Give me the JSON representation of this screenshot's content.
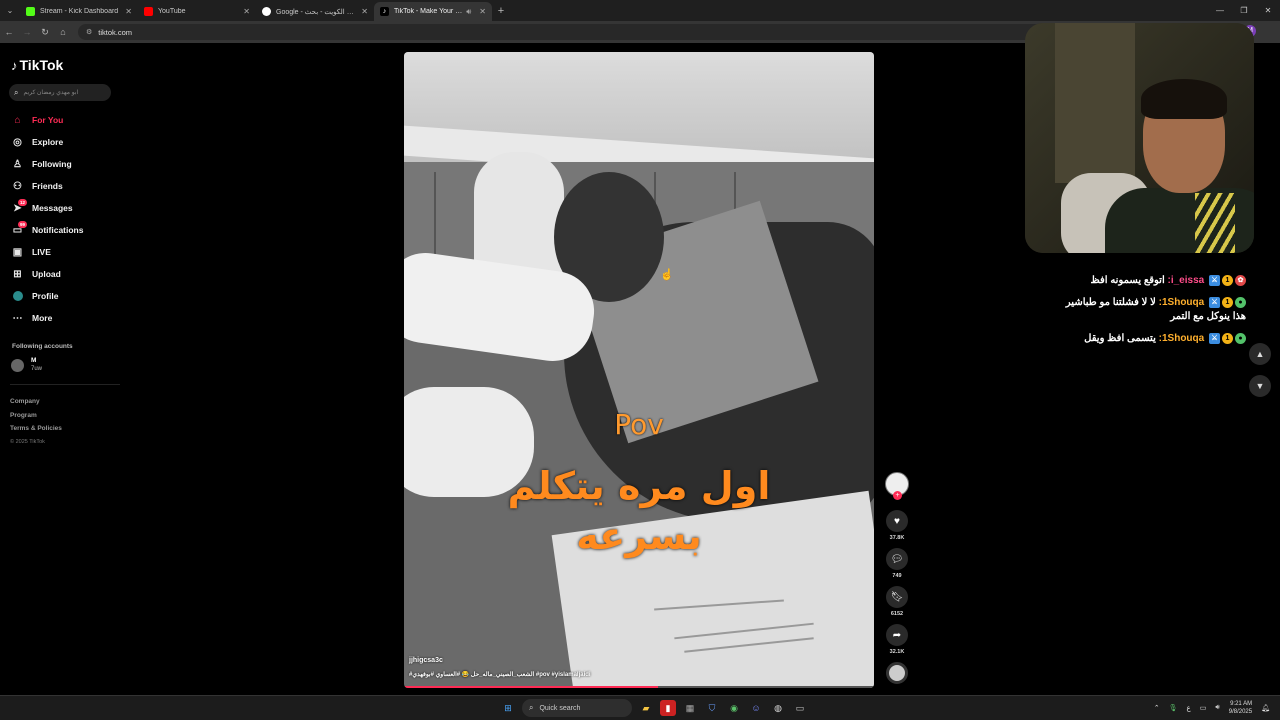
{
  "browser": {
    "tabs": [
      {
        "title": "Stream - Kick Dashboard",
        "favicon_color": "#53fc18",
        "active": false
      },
      {
        "title": "YouTube",
        "favicon_color": "#ff0000",
        "active": false
      },
      {
        "title": "Google - برجر جياني الكويت - بحث",
        "favicon_color": "#4285f4",
        "active": false
      },
      {
        "title": "TikTok - Make Your Day",
        "favicon_color": "#000000",
        "active": true
      }
    ],
    "url": "tiktok.com",
    "profile_initial": "M"
  },
  "sidebar": {
    "logo": "TikTok",
    "search_placeholder": "ابو مهدي رمضان كريم",
    "menu": [
      {
        "label": "For You",
        "icon": "home-icon",
        "active": true
      },
      {
        "label": "Explore",
        "icon": "compass-icon"
      },
      {
        "label": "Following",
        "icon": "person-icon"
      },
      {
        "label": "Friends",
        "icon": "people-icon"
      },
      {
        "label": "Messages",
        "icon": "send-icon",
        "badge": "12"
      },
      {
        "label": "Notifications",
        "icon": "inbox-icon",
        "badge": "99"
      },
      {
        "label": "LIVE",
        "icon": "live-icon"
      },
      {
        "label": "Upload",
        "icon": "upload-icon"
      },
      {
        "label": "Profile",
        "icon": "profile-avatar"
      },
      {
        "label": "More",
        "icon": "more-icon"
      }
    ],
    "following_title": "Following accounts",
    "account": {
      "name": "M",
      "handle": "7uw"
    },
    "footer": {
      "company": "Company",
      "program": "Program",
      "terms": "Terms & Policies",
      "copyright": "© 2025 TikTok"
    }
  },
  "video": {
    "caption_pov": "Pov",
    "caption_line1": "اول مره يتكلم",
    "caption_line2": "بسرعه",
    "username": "jjhigcsa3c",
    "tags": "#الشعب_الصيني_ماله_حل 😂 #العساوي #بوفهدي #pov #yislamaljaidi",
    "progress": 0.54
  },
  "actions": {
    "likes": "37.8K",
    "comments": "749",
    "saves": "6152",
    "shares": "32.1K"
  },
  "chat": [
    {
      "user": "i_eissa",
      "user_color": "#ff4d8a",
      "text": "اتوقع يسمونه افظ"
    },
    {
      "user": "1Shouqa",
      "user_color": "#ffb02e",
      "text": "لا لا فشلتنا مو طباشير هذا ينوكل مع التمر"
    },
    {
      "user": "1Shouqa",
      "user_color": "#ffb02e",
      "text": "يتسمى افظ ويقل"
    }
  ],
  "taskbar": {
    "search_label": "Quick search",
    "time": "9:21 AM",
    "date": "9/8/2025",
    "lang": "ع"
  }
}
